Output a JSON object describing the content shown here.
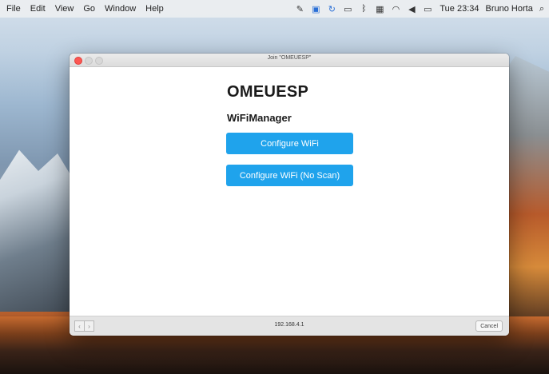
{
  "menubar": {
    "items": [
      "File",
      "Edit",
      "View",
      "Go",
      "Window",
      "Help"
    ],
    "status_icons": [
      "pen-icon",
      "display-icon",
      "sync-icon",
      "airplay-icon",
      "bluetooth-icon",
      "keyboard-icon",
      "wifi-icon",
      "volume-icon",
      "battery-icon"
    ],
    "clock": "Tue 23:34",
    "user": "Bruno Horta"
  },
  "window": {
    "title": "Join \"OMEUESP\"",
    "heading": "OMEUESP",
    "subheading": "WiFiManager",
    "buttons": [
      "Configure WiFi",
      "Configure WiFi (No Scan)"
    ],
    "address": "192.168.4.1",
    "cancel_label": "Cancel"
  },
  "colors": {
    "accent": "#1fa3ec",
    "close": "#fc5753"
  }
}
